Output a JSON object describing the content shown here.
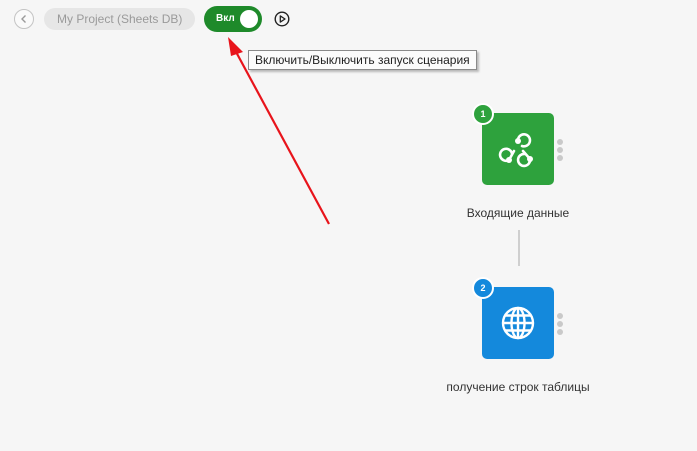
{
  "header": {
    "project_name": "My Project (Sheets DB)",
    "toggle_label": "Вкл",
    "toggle_state": "on"
  },
  "tooltip": {
    "text": "Включить/Выключить запуск сценария"
  },
  "flow": {
    "nodes": [
      {
        "number": "1",
        "label": "Входящие данные",
        "icon": "webhook-icon",
        "color": "#2ea23d"
      },
      {
        "number": "2",
        "label": "получение строк таблицы",
        "icon": "globe-icon",
        "color": "#1489dc"
      }
    ]
  },
  "colors": {
    "toggle_on": "#1e8a2a",
    "annotation_arrow": "#e8141b"
  }
}
